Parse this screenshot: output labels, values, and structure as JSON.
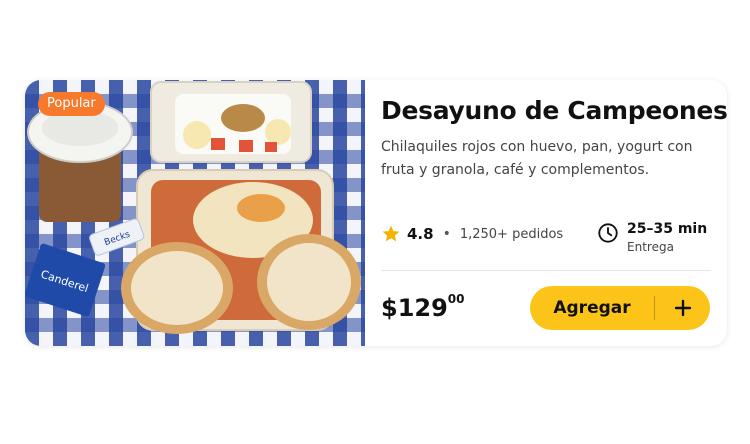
{
  "card": {
    "badge": "Popular",
    "title": "Desayuno de Campeones",
    "title_emoji": "🏆",
    "description": "Chilaquiles rojos con huevo, pan, yogurt con fruta y granola, café y complementos.",
    "rating": "4.8",
    "separator": "•",
    "orders": "1,250+ pedidos",
    "delivery_time": "25–35 min",
    "delivery_label": "Entrega",
    "price_main": "$129",
    "price_cents": "00",
    "add_button_label": "Agregar",
    "packet_label": "Canderel",
    "mini_label": "Becks"
  },
  "colors": {
    "badge": "#f7792b",
    "button": "#fcc419",
    "star": "#f5b301",
    "tablecloth": "#2846a0"
  },
  "icons": {
    "star": "star-icon",
    "clock": "clock-icon",
    "plus": "plus-icon",
    "trophy": "trophy-icon"
  }
}
